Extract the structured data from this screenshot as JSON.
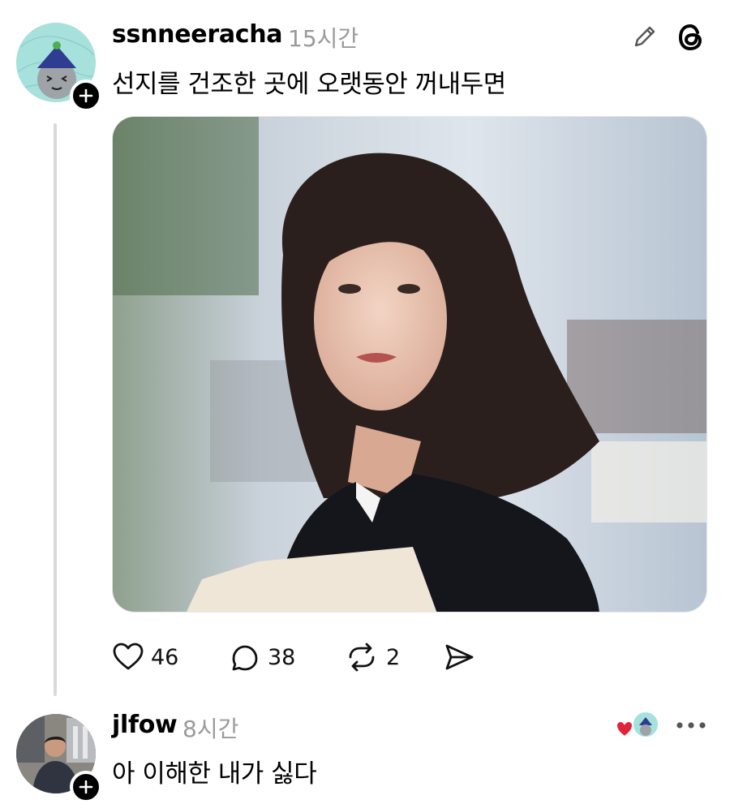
{
  "post": {
    "username": "ssnneeracha",
    "time": "15시간",
    "text": "선지를 건조한 곳에 오랫동안 꺼내두면",
    "likes": "46",
    "comments": "38",
    "reposts": "2"
  },
  "reply": {
    "username": "jlfow",
    "time": "8시간",
    "text": "아 이해한 내가 싫다"
  },
  "icons": {
    "edit": "pencil-icon",
    "app": "threads-logo-icon",
    "like": "heart-icon",
    "comment": "comment-icon",
    "repost": "repost-icon",
    "share": "share-icon",
    "more": "more-icon",
    "follow": "plus-icon"
  },
  "colors": {
    "liked_heart": "#e0243b",
    "muted_text": "#9a9a9a",
    "thread_line": "#d9d9d9"
  }
}
